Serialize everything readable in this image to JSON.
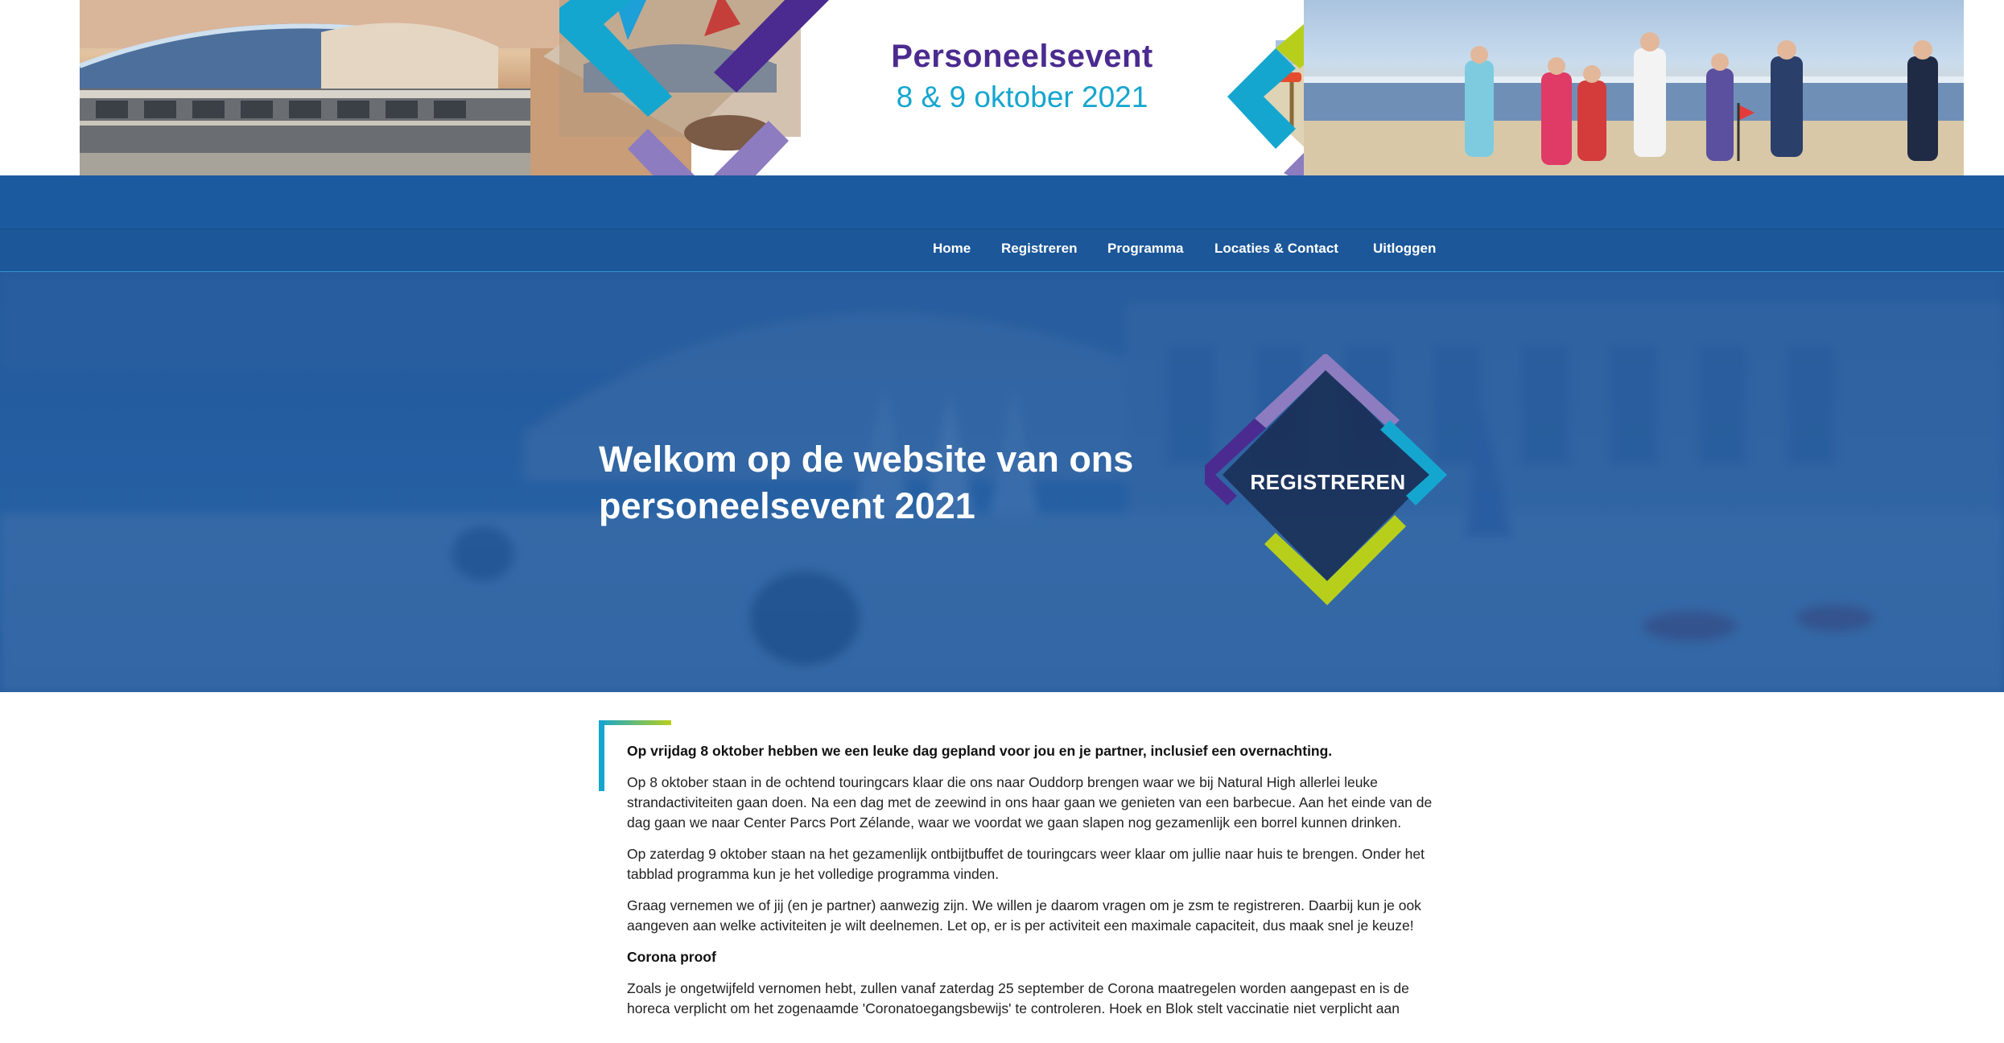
{
  "brand": {
    "title": "Personeelsevent",
    "subtitle": "8 & 9 oktober 2021"
  },
  "nav": {
    "items": [
      {
        "label": "Home"
      },
      {
        "label": "Registreren"
      },
      {
        "label": "Programma"
      },
      {
        "label": "Locaties & Contact"
      },
      {
        "label": "Uitloggen"
      }
    ]
  },
  "hero": {
    "title_line1": "Welkom op de website van ons",
    "title_line2": "personeelsevent 2021",
    "register_button": "REGISTREREN"
  },
  "content": {
    "intro_bold": "Op vrijdag 8 oktober hebben we een leuke dag gepland voor jou en je partner, inclusief een overnachting.",
    "paragraph1": "Op 8 oktober staan in de ochtend touringcars klaar die ons naar Ouddorp brengen waar we bij Natural High allerlei leuke strandactiviteiten gaan doen. Na een dag met de zeewind in ons haar gaan we genieten van een barbecue. Aan het einde van de dag gaan we naar Center Parcs Port Zélande, waar we voordat we gaan slapen nog gezamenlijk een borrel kunnen drinken.",
    "paragraph2": "Op zaterdag 9 oktober staan na het gezamenlijk ontbijtbuffet de touringcars weer klaar om jullie naar huis te brengen. Onder het tabblad programma kun je het volledige programma vinden.",
    "paragraph3": "Graag vernemen we of jij (en je partner) aanwezig zijn. We willen je daarom vragen om je zsm te registreren. Daarbij kun je ook aangeven aan welke activiteiten je wilt deelnemen. Let op, er is per activiteit een maximale capaciteit, dus maak snel je keuze!",
    "corona_heading": "Corona proof",
    "corona_text": "Zoals je ongetwijfeld vernomen hebt, zullen vanaf zaterdag 25 september de Corona maatregelen worden aangepast en is de horeca verplicht om het zogenaamde 'Coronatoegangsbewijs' te controleren. Hoek en Blok stelt vaccinatie niet verplicht aan"
  },
  "colors": {
    "purple": "#4b2b8f",
    "cyan": "#15a6cf",
    "lime": "#b7cf1b",
    "lavender": "#8d7cc0",
    "nav_blue": "#1b5799",
    "hero_blue": "#2c62a0"
  }
}
